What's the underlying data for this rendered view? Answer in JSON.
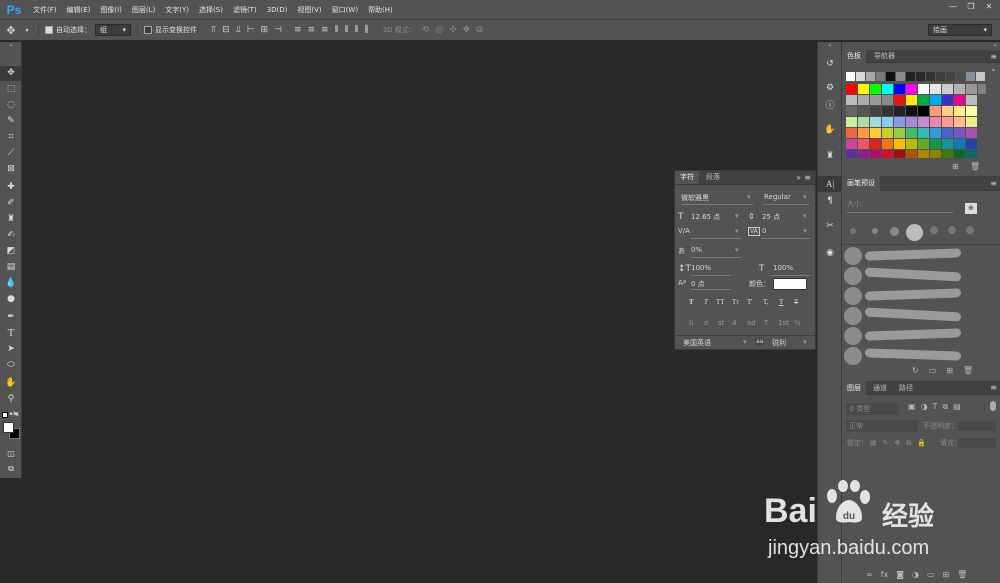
{
  "app": {
    "logo": "Ps"
  },
  "menu": [
    "文件(F)",
    "编辑(E)",
    "图像(I)",
    "图层(L)",
    "文字(Y)",
    "选择(S)",
    "滤镜(T)",
    "3D(D)",
    "视图(V)",
    "窗口(W)",
    "帮助(H)"
  ],
  "window_controls": {
    "minimize": "—",
    "restore": "❐",
    "close": "✕"
  },
  "options": {
    "auto_select_label": "自动选择：",
    "auto_select_value": "组",
    "show_transform_label": "显示变换控件",
    "mode_3d_label": "3D 模式：",
    "workspace": "绘画"
  },
  "tools": [
    "move-tool",
    "marquee-tool",
    "lasso-tool",
    "quick-select-tool",
    "crop-tool",
    "eyedropper-tool",
    "frame-tool",
    "healing-brush-tool",
    "brush-tool",
    "clone-stamp-tool",
    "history-brush-tool",
    "eraser-tool",
    "gradient-tool",
    "blur-tool",
    "dodge-tool",
    "pen-tool",
    "type-tool",
    "path-select-tool",
    "shape-tool",
    "hand-tool",
    "zoom-tool",
    "more-tools"
  ],
  "swatches_panel": {
    "tabs": [
      "色板",
      "导航器"
    ],
    "colors": [
      [
        "#ffffff",
        "#d9d9d9",
        "#aaaaaa",
        "#7a7a7a",
        "#111111",
        "#888888",
        "#222222",
        "#2a2a2a",
        "#333333",
        "#3c3c3c",
        "#444444",
        "#4d4d4d",
        "#8890a0",
        "#c7c7c7",
        "#999999",
        "#111111",
        "#1a1a1a",
        "#222222"
      ],
      [
        "#ff0000",
        "#ffff00",
        "#00ff00",
        "#00ffff",
        "#0000ff",
        "#ff00ff",
        "#ffffff",
        "#e6e6e6",
        "#cccccc",
        "#b3b3b3",
        "#999999",
        "#808080"
      ],
      [
        "#bbbbbb",
        "#aaaaaa",
        "#999999",
        "#888888",
        "#ee1111",
        "#ffee00",
        "#00aa44",
        "#00aaee",
        "#3333cc",
        "#ee0099",
        "#bbbbbb"
      ],
      [
        "#666666",
        "#555555",
        "#444444",
        "#333333",
        "#222222",
        "#111111",
        "#000000",
        "#ff9977",
        "#ffcc88",
        "#ffee88",
        "#ffffaa"
      ],
      [
        "#ccee99",
        "#aaddaa",
        "#99dddd",
        "#88ccee",
        "#8899ee",
        "#aa88dd",
        "#cc88cc",
        "#ee88aa",
        "#ff9999",
        "#ffbb88",
        "#eeee88"
      ],
      [
        "#ee6644",
        "#ff9944",
        "#ffcc33",
        "#cccc33",
        "#99cc44",
        "#44bb66",
        "#33bbbb",
        "#3399dd",
        "#4466cc",
        "#7755bb",
        "#aa55aa"
      ],
      [
        "#cc4499",
        "#ee5566",
        "#dd2222",
        "#ee7711",
        "#ffbb00",
        "#bbbb00",
        "#66aa22",
        "#119944",
        "#119999",
        "#1177bb",
        "#2244aa"
      ],
      [
        "#553399",
        "#882288",
        "#aa1166",
        "#cc1133",
        "#991111",
        "#aa5500",
        "#aa8800",
        "#888800",
        "#447711",
        "#116633",
        "#116666"
      ]
    ]
  },
  "character_panel": {
    "tabs": [
      "字符",
      "段落"
    ],
    "collapse": "»",
    "font_family": "微软雅黑",
    "font_style": "Regular",
    "font_size": "12.65 点",
    "leading": "25 点",
    "kerning_label": "V/A",
    "kerning": "",
    "tracking_label": "VA",
    "tracking": "0",
    "scale_pct": "0%",
    "vert_scale": "100%",
    "horiz_scale": "100%",
    "baseline_shift": "0 点",
    "color_label": "颜色：",
    "language": "美国英语",
    "aa_label": "aa",
    "antialias": "锐利",
    "style_buttons": [
      "T",
      "T",
      "TT",
      "Tт",
      "T'",
      "T,",
      "T",
      "T"
    ],
    "opentype_buttons": [
      "fi",
      "ơ",
      "st",
      "A",
      "ad",
      "T",
      "1st",
      "½"
    ]
  },
  "brush_presets_panel": {
    "tabs": [
      "画笔预设"
    ],
    "size_label": "大小：",
    "bottom_icons": [
      "toggle-icon",
      "folder-icon",
      "new-icon",
      "trash-icon"
    ]
  },
  "layers_panel": {
    "tabs": [
      "图层",
      "通道",
      "路径"
    ],
    "filter_label": "类型",
    "blend_mode": "正常",
    "opacity_label": "不透明度：",
    "lock_label": "锁定：",
    "fill_label": "填充：",
    "bottom_icons": [
      "link-icon",
      "fx-icon",
      "mask-icon",
      "adjust-icon",
      "group-icon",
      "new-layer-icon",
      "trash-icon"
    ]
  },
  "watermark": {
    "brand_left": "Bai",
    "brand_right": "经验",
    "url": "jingyan.baidu.com"
  }
}
